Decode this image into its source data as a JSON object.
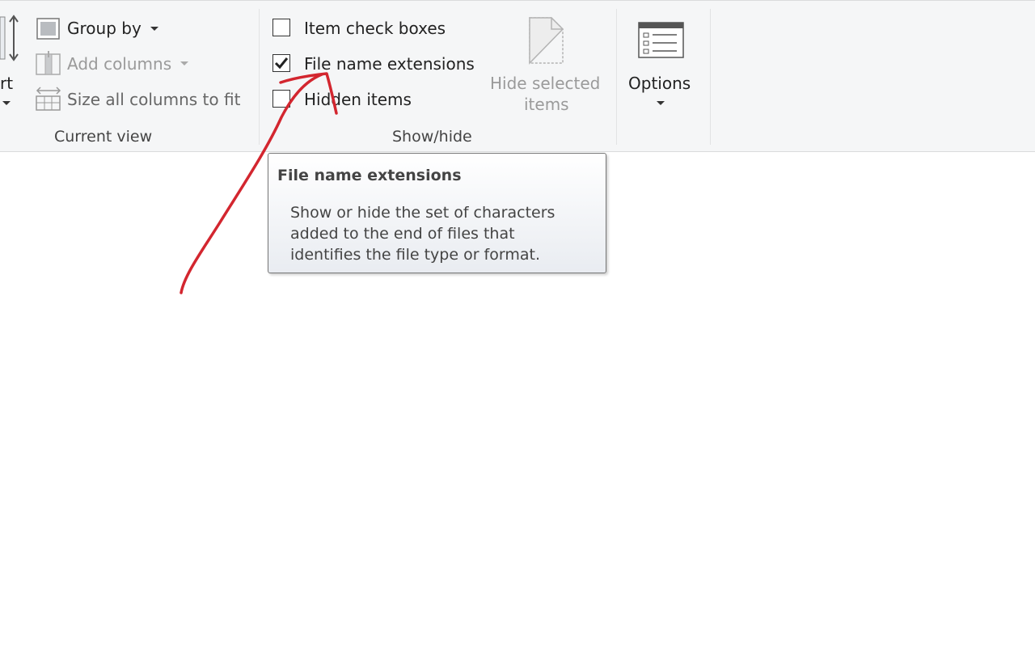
{
  "current_view": {
    "partial_button_label": "rt",
    "group_by_label": "Group by",
    "add_columns_label": "Add columns",
    "size_columns_label": "Size all columns to fit",
    "group_label": "Current view"
  },
  "show_hide": {
    "item_check_boxes_label": "Item check boxes",
    "item_check_boxes_checked": false,
    "file_name_extensions_label": "File name extensions",
    "file_name_extensions_checked": true,
    "hidden_items_label": "Hidden items",
    "hidden_items_checked": false,
    "hide_selected_line1": "Hide selected",
    "hide_selected_line2": "items",
    "group_label": "Show/hide"
  },
  "options": {
    "label": "Options"
  },
  "tooltip": {
    "title": "File name extensions",
    "body": "Show or hide the set of characters added to the end of files that identifies the file type or format."
  },
  "colors": {
    "annotation": "#d3262f",
    "ribbon_bg": "#f5f6f7",
    "disabled_text": "#9a9a9a"
  }
}
